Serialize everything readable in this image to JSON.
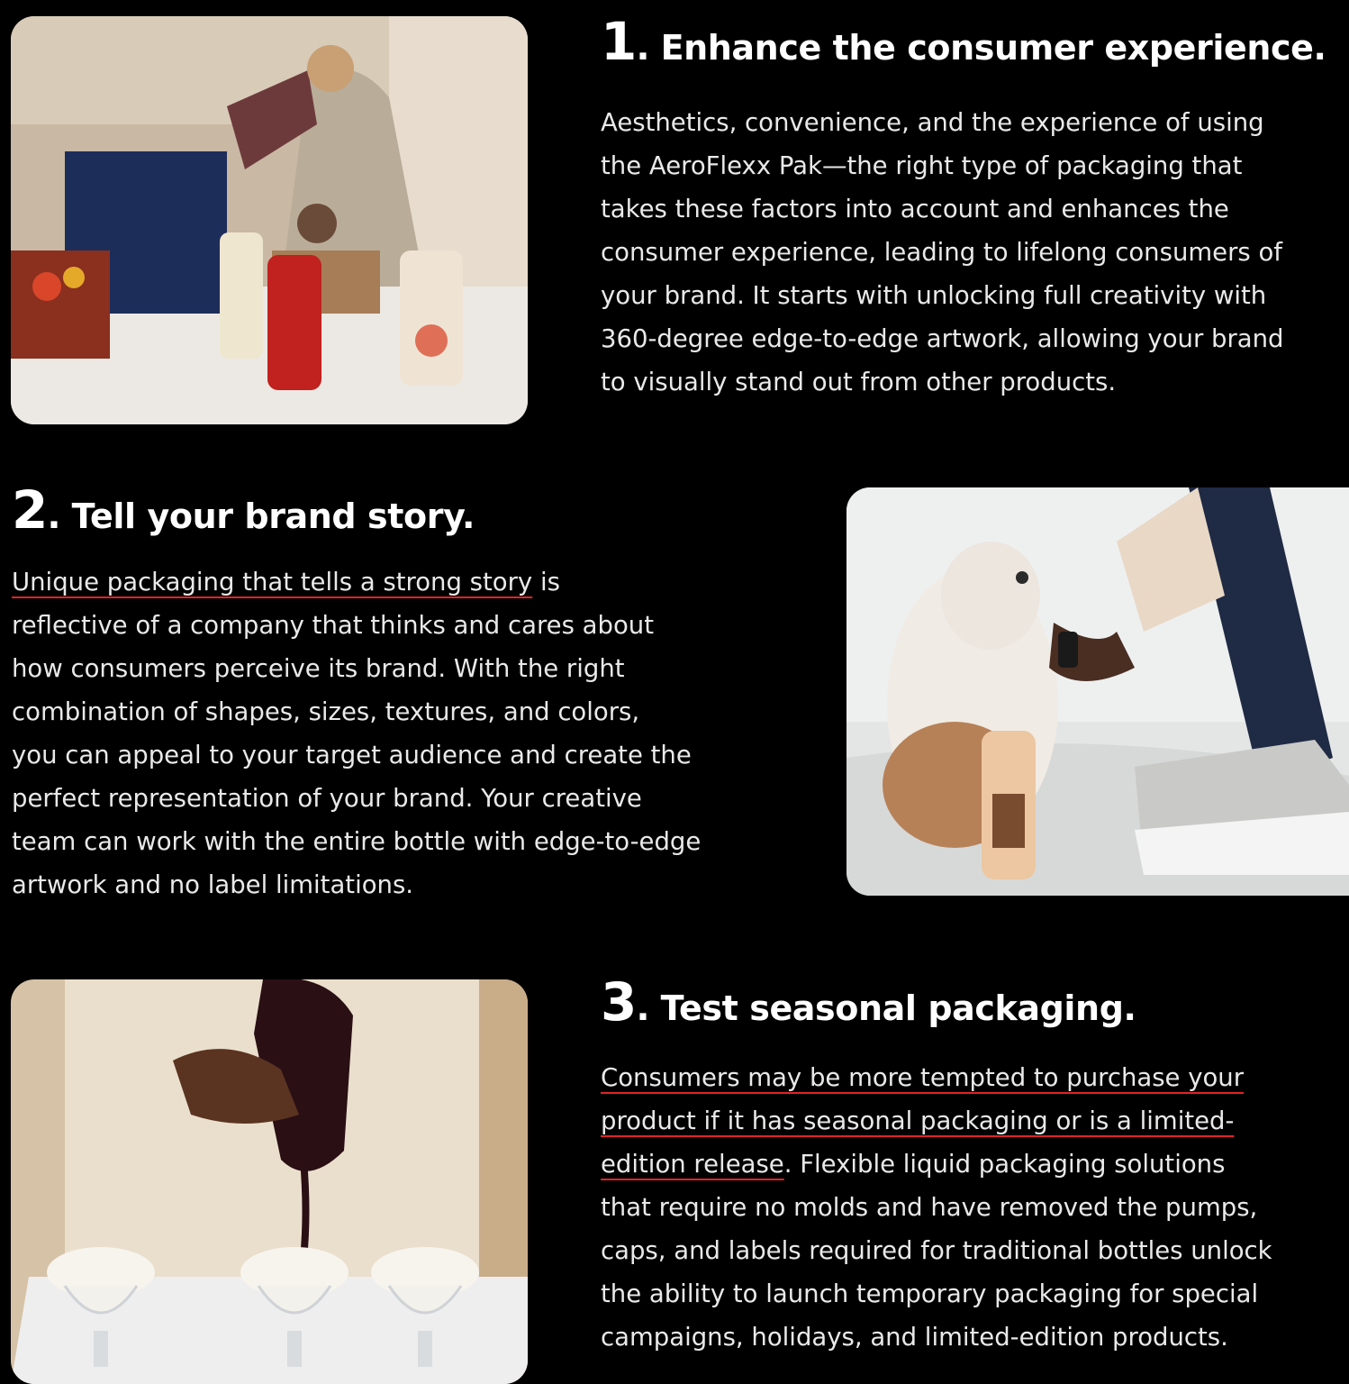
{
  "sections": [
    {
      "number": "1",
      "title": "Enhance the consumer experience.",
      "lines": [
        "Aesthetics, convenience, and the experience of using",
        "the AeroFlexx Pak—the right type of packaging that",
        "takes these factors into account and enhances the",
        "consumer experience, leading to lifelong consumers of",
        "your brand. It starts with unlocking full creativity with",
        "360-degree edge-to-edge artwork, allowing your brand",
        "to visually stand out from other products."
      ]
    },
    {
      "number": "2",
      "title": "Tell your brand story.",
      "link": "Unique packaging that tells a strong story",
      "lines": [
        " is",
        "reflective of a company that thinks and cares about",
        "how consumers perceive its brand. With the right",
        "combination of shapes, sizes, textures, and colors,",
        "you can appeal to your target audience and create the",
        "perfect representation of your brand. Your creative",
        "team can work with the entire bottle with edge-to-edge",
        "artwork and no label limitations."
      ]
    },
    {
      "number": "3",
      "title": "Test seasonal packaging.",
      "link_lines": [
        "Consumers may be more tempted to purchase your",
        "product if it has seasonal packaging or is a limited-",
        "edition release"
      ],
      "lines": [
        ". Flexible liquid packaging solutions",
        "that require no molds and have removed the pumps,",
        "caps, and labels required for traditional bottles unlock",
        "the ability to launch temporary packaging for special",
        "campaigns, holidays, and limited-edition products."
      ]
    }
  ],
  "product_brand": "AEROFLEX",
  "colors": {
    "background": "#000000",
    "text": "#ffffff",
    "link_underline": "#e02424"
  }
}
